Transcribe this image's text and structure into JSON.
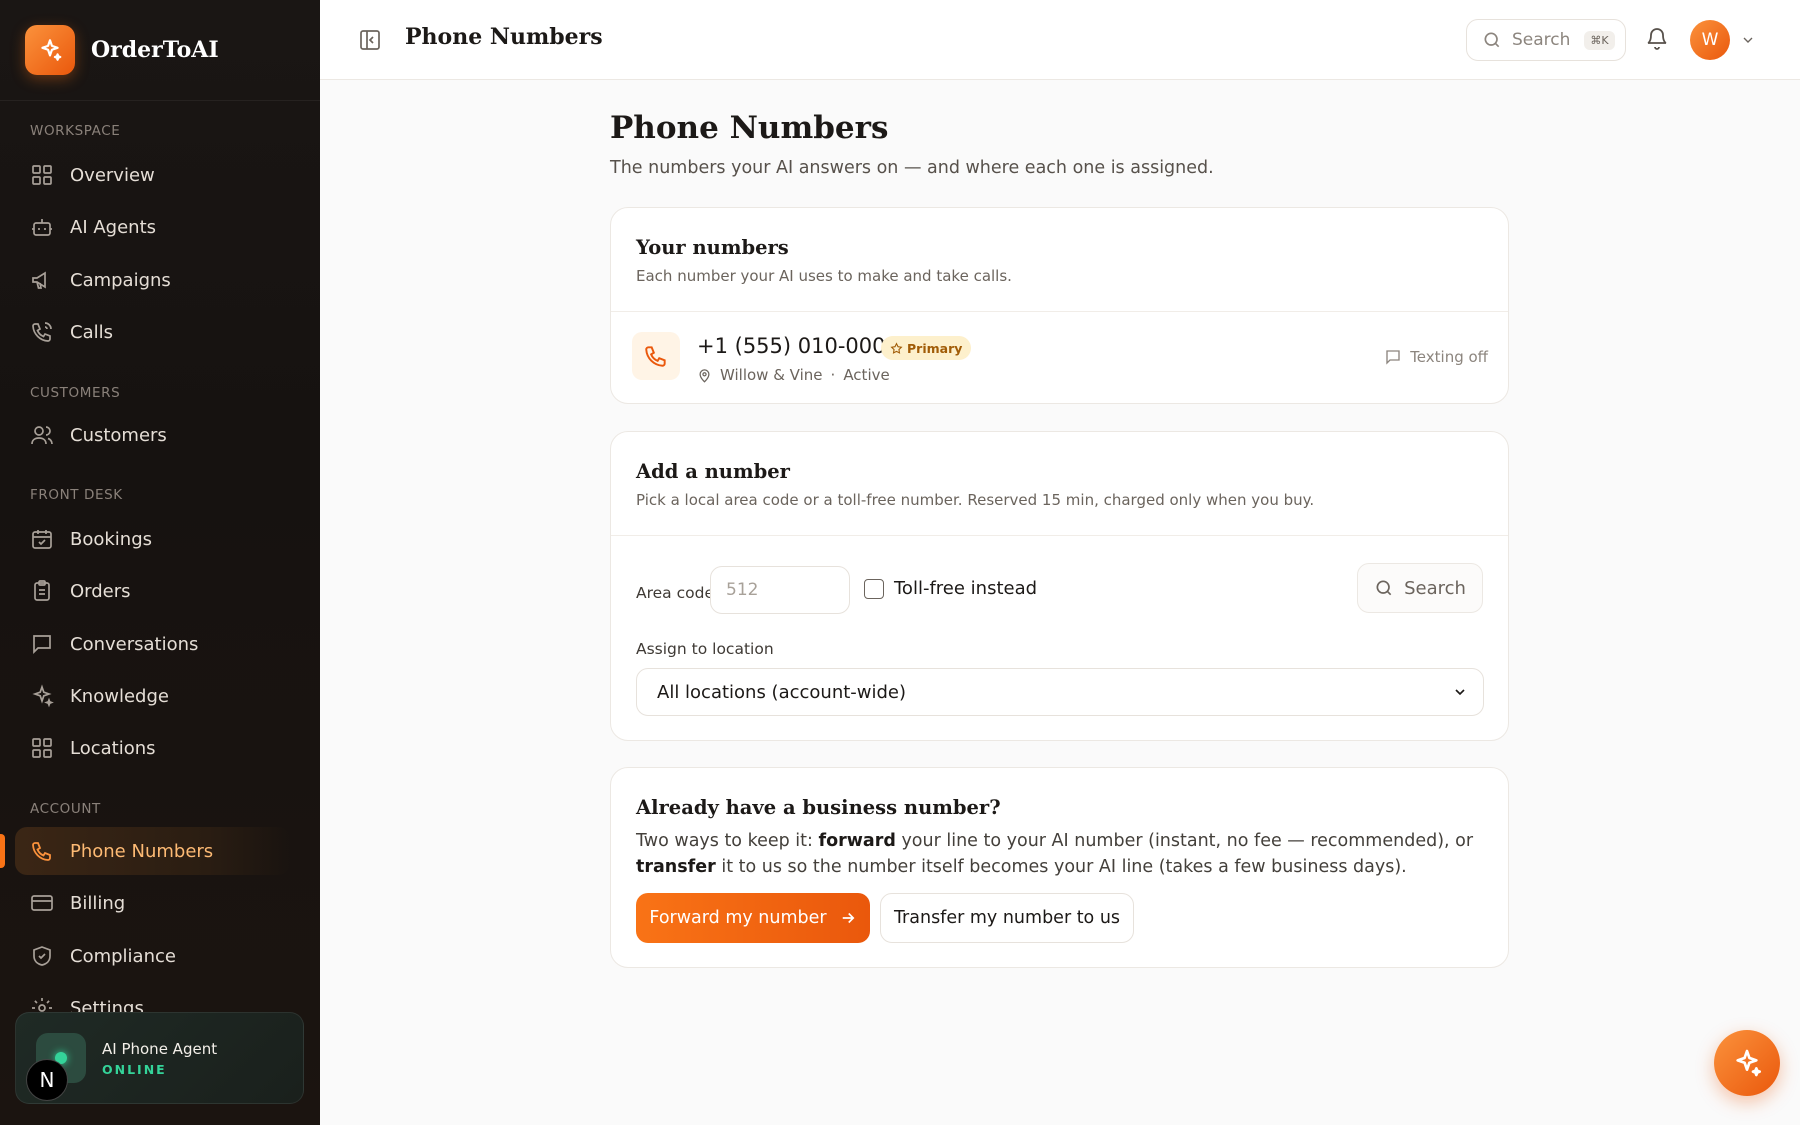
{
  "app": {
    "name": "OrderToAI"
  },
  "sidebar": {
    "sections": [
      {
        "label": "WORKSPACE",
        "items": [
          "Overview",
          "AI Agents",
          "Campaigns",
          "Calls"
        ]
      },
      {
        "label": "CUSTOMERS",
        "items": [
          "Customers"
        ]
      },
      {
        "label": "FRONT DESK",
        "items": [
          "Bookings",
          "Orders",
          "Conversations",
          "Knowledge",
          "Locations"
        ]
      },
      {
        "label": "ACCOUNT",
        "items": [
          "Phone Numbers",
          "Billing",
          "Compliance",
          "Settings"
        ]
      }
    ],
    "active_item": "Phone Numbers",
    "agent": {
      "name": "AI Phone Agent",
      "status": "ONLINE"
    },
    "corner_badge": "N"
  },
  "topbar": {
    "title": "Phone Numbers",
    "search_label": "Search",
    "search_shortcut": "⌘K",
    "avatar_initial": "W"
  },
  "page": {
    "title": "Phone Numbers",
    "subtitle": "The numbers your AI answers on — and where each one is assigned."
  },
  "your_numbers": {
    "title": "Your numbers",
    "subtitle": "Each number your AI uses to make and take calls.",
    "numbers": [
      {
        "number": "+1 (555) 010-0001",
        "badge": "Primary",
        "location": "Willow & Vine",
        "status": "Active",
        "texting": "Texting off"
      }
    ]
  },
  "add_number": {
    "title": "Add a number",
    "subtitle": "Pick a local area code or a toll-free number. Reserved 15 min, charged only when you buy.",
    "area_code_label": "Area code",
    "area_code_placeholder": "512",
    "toll_free_label": "Toll-free instead",
    "toll_free_checked": false,
    "search_label": "Search",
    "location_label": "Assign to location",
    "location_selected": "All locations (account-wide)"
  },
  "business_number": {
    "title": "Already have a business number?",
    "text_1": "Two ways to keep it: ",
    "bold_1": "forward",
    "text_2": " your line to your AI number (instant, no fee — recommended), or ",
    "bold_2": "transfer",
    "text_3": " it to us so the number itself becomes your AI line (takes a few business days).",
    "forward_button": "Forward my number",
    "transfer_button": "Transfer my number to us"
  },
  "colors": {
    "accent": "#f97316",
    "sidebar_bg": "#1a1614",
    "online": "#34d399",
    "badge_bg": "#fdf0cc"
  },
  "icons": {
    "nav": [
      "grid-icon",
      "robot-icon",
      "megaphone-icon",
      "phone-call-icon",
      "users-icon",
      "calendar-icon",
      "clipboard-icon",
      "chat-icon",
      "sparkle-icon",
      "grid-icon",
      "phone-icon",
      "credit-card-icon",
      "shield-check-icon",
      "gear-icon"
    ]
  }
}
